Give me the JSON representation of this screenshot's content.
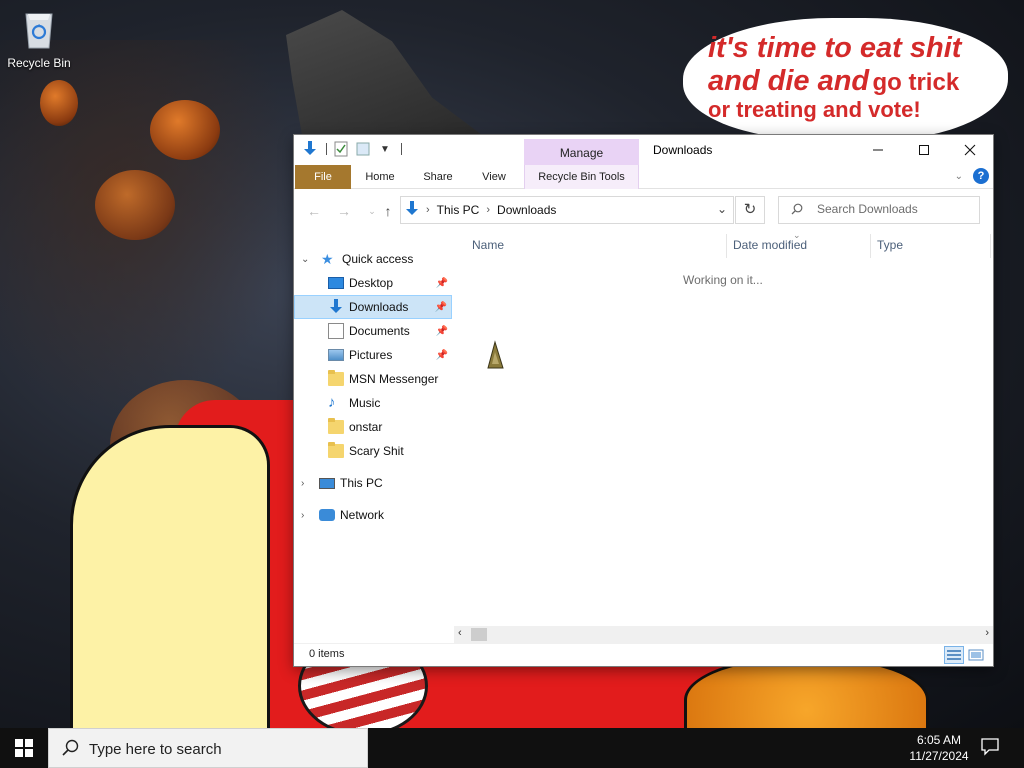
{
  "desktop": {
    "icons": [
      {
        "label": "Recycle Bin",
        "icon": "recycle-bin-icon"
      }
    ],
    "wallpaper_text": [
      "it's time to eat shit",
      "and die and",
      "go trick",
      "or treating and vote!"
    ]
  },
  "window": {
    "title": "Downloads",
    "contextual_group": "Manage",
    "ribbon_tabs": [
      "File",
      "Home",
      "Share",
      "View",
      "Recycle Bin Tools"
    ],
    "address": {
      "crumbs": [
        "This PC",
        "Downloads"
      ]
    },
    "search": {
      "placeholder": "Search Downloads"
    },
    "nav": {
      "quick_access": "Quick access",
      "items": [
        {
          "label": "Desktop",
          "icon": "desktop-icon",
          "pinned": true
        },
        {
          "label": "Downloads",
          "icon": "downloads-icon",
          "pinned": true,
          "selected": true
        },
        {
          "label": "Documents",
          "icon": "documents-icon",
          "pinned": true
        },
        {
          "label": "Pictures",
          "icon": "pictures-icon",
          "pinned": true
        },
        {
          "label": "MSN Messenger",
          "icon": "folder-icon"
        },
        {
          "label": "Music",
          "icon": "music-icon"
        },
        {
          "label": "onstar",
          "icon": "folder-icon"
        },
        {
          "label": "Scary Shit",
          "icon": "folder-icon"
        }
      ],
      "this_pc": "This PC",
      "network": "Network"
    },
    "columns": [
      "Name",
      "Date modified",
      "Type"
    ],
    "status_message": "Working on it...",
    "item_count": "0 items"
  },
  "taskbar": {
    "search_placeholder": "Type here to search",
    "time": "6:05 AM",
    "date": "11/27/2024"
  },
  "colors": {
    "accent": "#0078d7",
    "file_tab": "#a5782e",
    "manage_tab": "#e9d3f5",
    "selection": "#cce4f7"
  }
}
